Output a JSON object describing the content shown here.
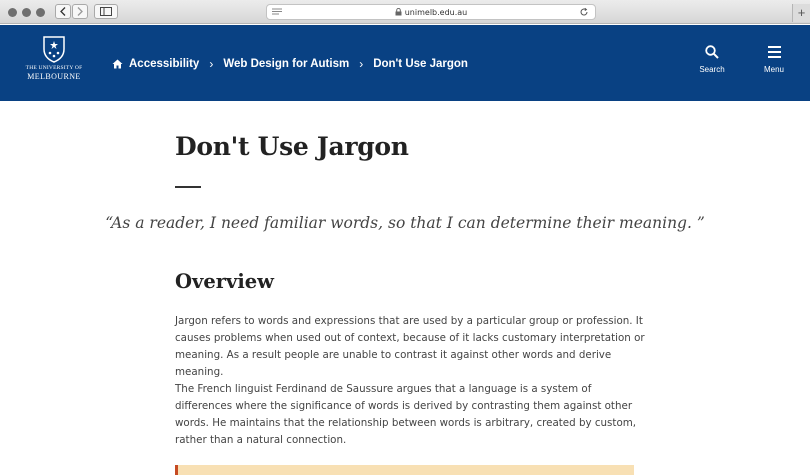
{
  "browser": {
    "url": "unimelb.edu.au",
    "new_tab": "+"
  },
  "header": {
    "logo": {
      "line1": "THE UNIVERSITY OF",
      "line2": "MELBOURNE"
    },
    "breadcrumb": [
      {
        "label": "Accessibility"
      },
      {
        "label": "Web Design for Autism"
      },
      {
        "label": "Don't Use Jargon"
      }
    ],
    "search_label": "Search",
    "menu_label": "Menu"
  },
  "content": {
    "title": "Don't Use Jargon",
    "quote": "“As a reader, I need familiar words, so that I can determine their meaning. ”",
    "section_title": "Overview",
    "paragraphs": [
      "Jargon refers to words and expressions that are used by a particular group or profession. It causes problems when used out of context, because of it lacks customary interpretation or meaning. As a result people are unable to contrast it against other words and derive meaning.",
      "The French linguist Ferdinand de Saussure argues that a language is a system of differences where the significance of words is derived by contrasting them against other words. He maintains that the relationship between words is arbitrary, created by custom, rather than a natural connection."
    ]
  },
  "colors": {
    "header_bg": "#094183",
    "callout_bg": "#f8e0b4",
    "callout_accent": "#c64a23"
  }
}
